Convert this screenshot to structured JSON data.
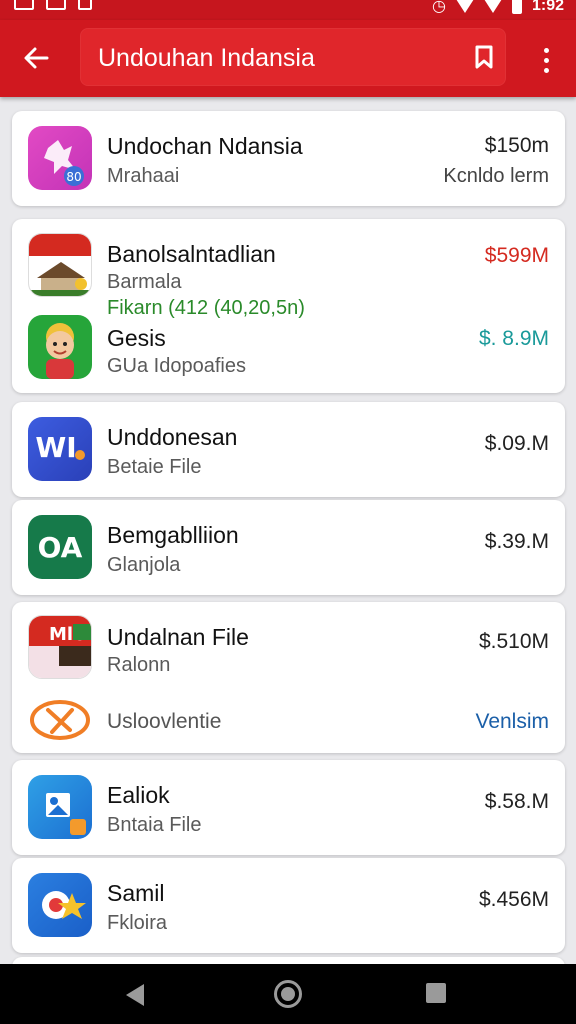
{
  "status_bar": {
    "time": "1:92",
    "left_icons": [
      "mail-icon",
      "message-icon",
      "notification-icon"
    ],
    "right_icons": [
      "alarm-icon",
      "signal-icon",
      "no-sim-icon",
      "battery-icon"
    ]
  },
  "app_bar": {
    "title": "Undouhan Indansia",
    "icons": [
      "back-arrow-icon",
      "bookmark-icon",
      "more-vert-icon"
    ],
    "color": "#d0181f"
  },
  "list": [
    {
      "name": "Undochan Ndansia",
      "subtitle": "Mrahaai",
      "size": "$150m",
      "size_note": "Kcnldo lerm",
      "icon": "app-icon-magenta"
    },
    {
      "name": "Banolsalntadlian",
      "subtitle": "Barmala",
      "size": "$599M",
      "size_color": "#d42a20",
      "extra": "Fikarn (412 (40,20,5n)",
      "icon": "app-icon-flag-house"
    },
    {
      "name": "Gesis",
      "subtitle": "GUa Idopoafies",
      "size": "$. 8.9M",
      "size_color": "#1a9a9a",
      "icon": "app-icon-avatar"
    },
    {
      "name": "Unddonesan",
      "subtitle": "Betaie File",
      "size": "$.09.M",
      "icon": "app-icon-wi"
    },
    {
      "name": "Bemgablliion",
      "subtitle": "Glanjola",
      "size": "$.39.M",
      "icon": "app-icon-oa"
    },
    {
      "name": "Undalnan File",
      "subtitle": "Ralonn",
      "size": "$.510M",
      "icon": "app-icon-mlc"
    },
    {
      "name": "Usloovlentie",
      "size": "Venlsim",
      "size_color": "#1b5fa8",
      "icon": "app-icon-orange-outline"
    },
    {
      "name": "Ealiok",
      "subtitle": "Bntaia File",
      "size": "$.58.M",
      "icon": "app-icon-blue-photo"
    },
    {
      "name": "Samil",
      "subtitle": "Fkloira",
      "size": "$.456M",
      "icon": "app-icon-blue-star"
    }
  ],
  "nav_bar": {
    "icons": [
      "nav-back-icon",
      "nav-home-icon",
      "nav-recents-icon"
    ]
  }
}
